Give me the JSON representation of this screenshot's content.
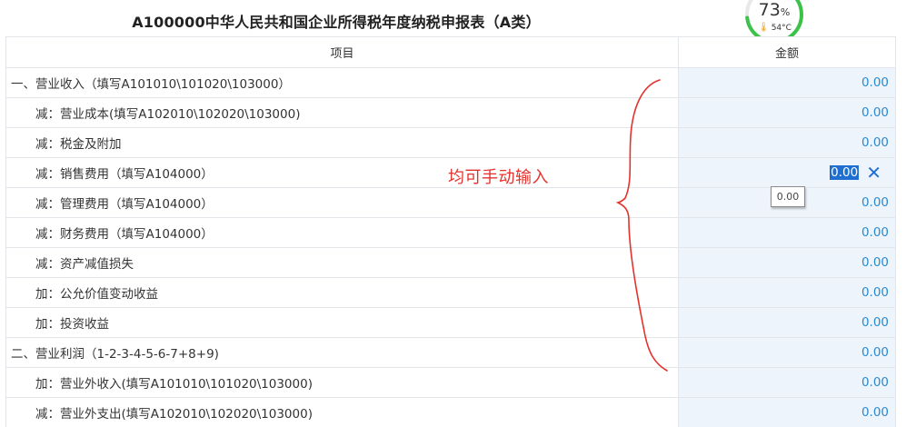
{
  "title": "A100000中华人民共和国企业所得税年度纳税申报表（A类）",
  "gauge": {
    "percent": "73",
    "percent_unit": "%",
    "temperature": "54°C",
    "level": 0.73,
    "color": "#3cc24a"
  },
  "table": {
    "headers": {
      "item": "项目",
      "amount": "金额"
    },
    "rows": [
      {
        "label": "一、营业收入（填写A101010\\101020\\103000）",
        "amount": "0.00"
      },
      {
        "label": "减：营业成本(填写A102010\\102020\\103000)",
        "amount": "0.00"
      },
      {
        "label": "减：税金及附加",
        "amount": "0.00"
      },
      {
        "label": "减：销售费用（填写A104000）",
        "amount": "0.00"
      },
      {
        "label": "减：管理费用（填写A104000）",
        "amount": "0.00"
      },
      {
        "label": "减：财务费用（填写A104000）",
        "amount": "0.00"
      },
      {
        "label": "减：资产减值损失",
        "amount": "0.00"
      },
      {
        "label": "加：公允价值变动收益",
        "amount": "0.00"
      },
      {
        "label": "加：投资收益",
        "amount": "0.00"
      },
      {
        "label": "二、营业利润（1-2-3-4-5-6-7+8+9)",
        "amount": "0.00"
      },
      {
        "label": "加：营业外收入(填写A101010\\101020\\103000)",
        "amount": "0.00"
      },
      {
        "label": "减：营业外支出(填写A102010\\102020\\103000)",
        "amount": "0.00"
      }
    ]
  },
  "editor": {
    "value": "0.00",
    "clear_icon": "close-icon"
  },
  "tooltip": "0.00",
  "annotation": "均可手动输入",
  "colors": {
    "amount_text": "#2a8ad0",
    "amount_bg": "#eef4fb",
    "annotation": "#e5312b",
    "selection": "#1f6fd0"
  }
}
